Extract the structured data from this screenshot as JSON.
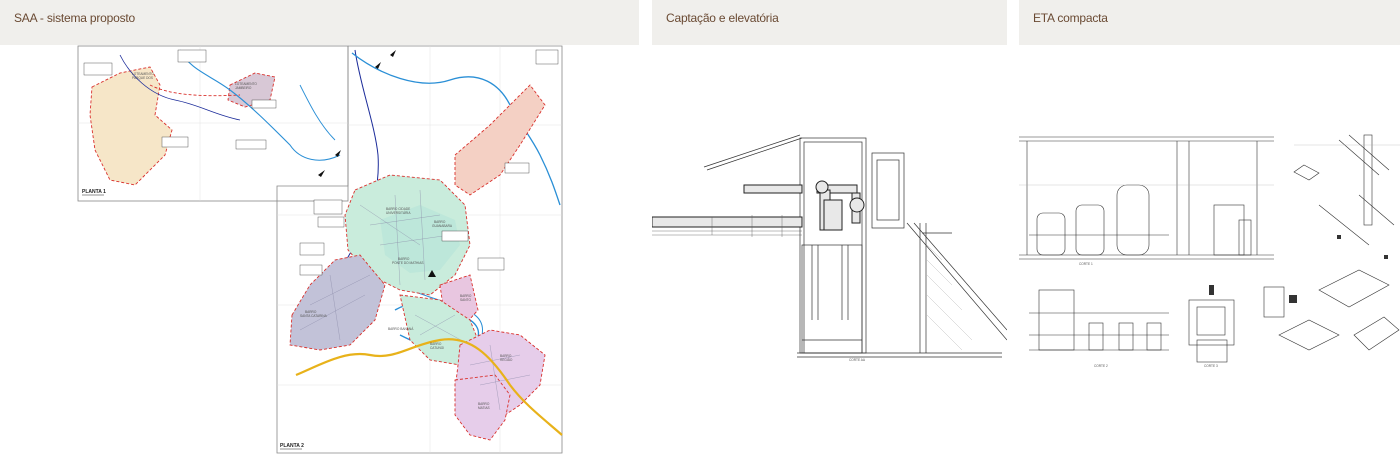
{
  "panels": [
    {
      "title": "SAA - sistema proposto",
      "plan_labels": [
        "PLANTA 1",
        "PLANTA 2"
      ],
      "neighborhoods": [
        "LOTEAMENTO PARQUE DOS PASSARINHOS",
        "LOTEAMENTO JAMBEIRO",
        "BAIRRO CIDADE UNIVERSITÁRIA",
        "BAIRRO GUANABARA",
        "BAIRRO PONTE DO MATHIAS",
        "BAIRRO SANTA CATARINA",
        "BAIRRO SANTO ANTÔNIO",
        "BAIRRO BANANÁ",
        "BAIRRO CATUNGI",
        "BAIRRO REGIÃO",
        "BAIRRO MATIAS"
      ]
    },
    {
      "title": "Captação e elevatória",
      "drawing_label": "CORTE AA"
    },
    {
      "title": "ETA compacta",
      "drawing_labels": [
        "CORTE 1",
        "CORTE 2",
        "CORTE 3"
      ]
    }
  ],
  "colors": {
    "header_bg": "#f0efec",
    "header_text": "#6a4a33",
    "boundary_red": "#d9302c",
    "river_blue": "#2a8fd6",
    "road_yellow": "#e8b21a"
  }
}
